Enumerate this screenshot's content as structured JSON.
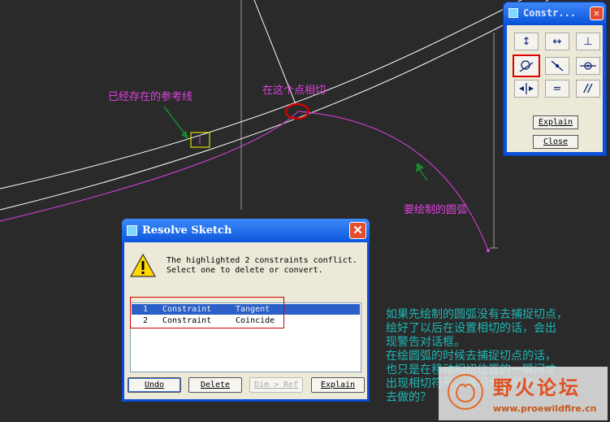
{
  "annotations": {
    "existing_ref_line": "已经存在的参考线",
    "tangent_at_point": "在这个点相切",
    "arc_to_draw": "要绘制的圆弧",
    "explanation_lines": [
      "如果先绘制的圆弧没有去捕捉切点，",
      "绘好了以后在设置相切的话，会出",
      "现警告对话框。",
      "在绘圆弧的时候去捕捉切点的话，",
      "也只是在移动相切位置的一瞬间才",
      "出现相切符号，请问大家是怎么",
      "去做的？"
    ]
  },
  "constraints_palette": {
    "title": "Constr...",
    "buttons": [
      {
        "name": "vertical-constraint",
        "icon": "↕"
      },
      {
        "name": "horizontal-constraint",
        "icon": "↔"
      },
      {
        "name": "perpendicular-constraint",
        "icon": "⊥"
      },
      {
        "name": "tangent-constraint",
        "icon": "tangent"
      },
      {
        "name": "point-on-line-constraint",
        "icon": "point-on-line"
      },
      {
        "name": "midpoint-constraint",
        "icon": "midpoint"
      },
      {
        "name": "symmetric-constraint",
        "icon": "symmetric"
      },
      {
        "name": "equal-constraint",
        "icon": "="
      },
      {
        "name": "parallel-constraint",
        "icon": "//"
      }
    ],
    "active_button": "tangent-constraint",
    "explain_label": "Explain",
    "close_label": "Close"
  },
  "resolve_dialog": {
    "title": "Resolve Sketch",
    "message": "The highlighted 2 constraints conflict.\nSelect one to delete or convert.",
    "rows": [
      {
        "index": "1",
        "type": "Constraint",
        "name": "Tangent",
        "selected": true
      },
      {
        "index": "2",
        "type": "Constraint",
        "name": "Coincide",
        "selected": false
      }
    ],
    "undo_label": "Undo",
    "delete_label": "Delete",
    "dimref_label": "Dim > Ref",
    "explain_label": "Explain"
  },
  "watermark": {
    "title": "野火论坛",
    "url": "www.proewildfire.cn"
  },
  "colors": {
    "annotation_magenta": "#e040e0",
    "annotation_teal": "#1fb7b7",
    "highlight_red": "#d00000",
    "highlight_yellow": "#ffff00",
    "arrow_green": "#1a8a2a"
  }
}
